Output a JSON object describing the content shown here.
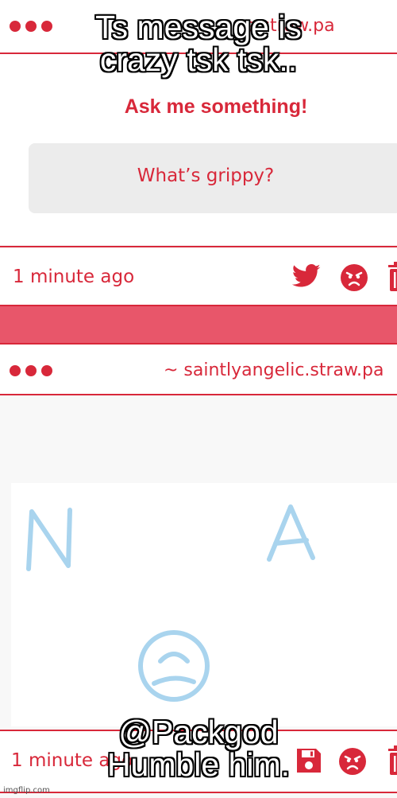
{
  "meme": {
    "top_caption": [
      "Ts message is",
      "crazy tsk tsk.."
    ],
    "bottom_caption": [
      "@Packgod",
      "Humble him."
    ],
    "watermark": "imgflip.com"
  },
  "top_card": {
    "url": "~ saintlyangelic.straw.page",
    "url_visible": "e  straw.pa",
    "ask_title": "Ask me something!",
    "question": "What’s grippy?",
    "time": "1 minute ago",
    "icons": [
      "twitter-icon",
      "angry-face-icon",
      "trash-icon"
    ]
  },
  "bottom_card": {
    "url": "~ saintlyangelic.straw.pa",
    "drawing_letters": [
      "N",
      "A"
    ],
    "drawing_face": "sad-face",
    "time": "1 minute ago",
    "icons": [
      "save-icon",
      "angry-face-icon",
      "trash-icon"
    ]
  },
  "colors": {
    "accent": "#d8283a",
    "divider": "#e8566a",
    "drawing_ink": "#a9d4ee"
  }
}
